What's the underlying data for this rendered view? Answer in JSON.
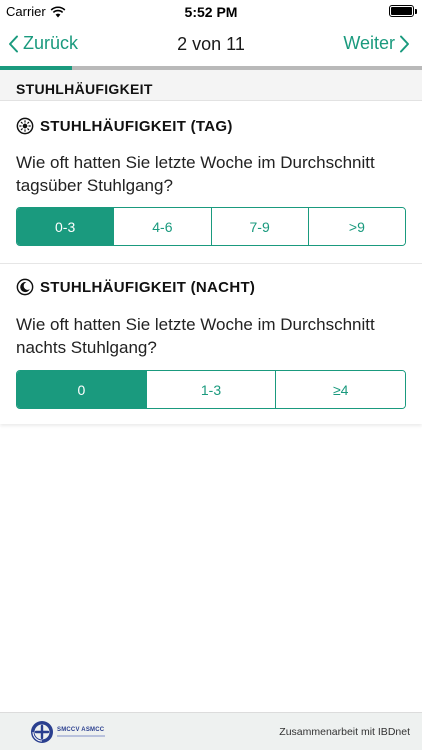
{
  "status_bar": {
    "carrier": "Carrier",
    "time": "5:52 PM"
  },
  "nav": {
    "back_label": "Zurück",
    "title": "2 von 11",
    "next_label": "Weiter"
  },
  "progress": {
    "fraction": 0.17
  },
  "section": {
    "title": "STUHLHÄUFIGKEIT"
  },
  "questions": [
    {
      "icon": "sun-icon",
      "title": "STUHLHÄUFIGKEIT (TAG)",
      "text": "Wie oft hatten Sie letzte Woche im Durchschnitt tagsüber Stuhlgang?",
      "options": [
        "0-3",
        "4-6",
        "7-9",
        ">9"
      ],
      "selected": "0-3"
    },
    {
      "icon": "moon-icon",
      "title": "STUHLHÄUFIGKEIT (NACHT)",
      "text": "Wie oft hatten Sie letzte Woche im Durchschnitt nachts Stuhlgang?",
      "options": [
        "0",
        "1-3",
        "≥4"
      ],
      "selected": "0"
    }
  ],
  "footer": {
    "logo_text": "SMCCV ASMCC",
    "credit": "Zusammenarbeit mit IBDnet"
  },
  "colors": {
    "accent": "#1a9a7e",
    "progress_track": "#b9b9b9",
    "section_background": "#f4f4f4",
    "logo_blue": "#2a3f8f"
  }
}
